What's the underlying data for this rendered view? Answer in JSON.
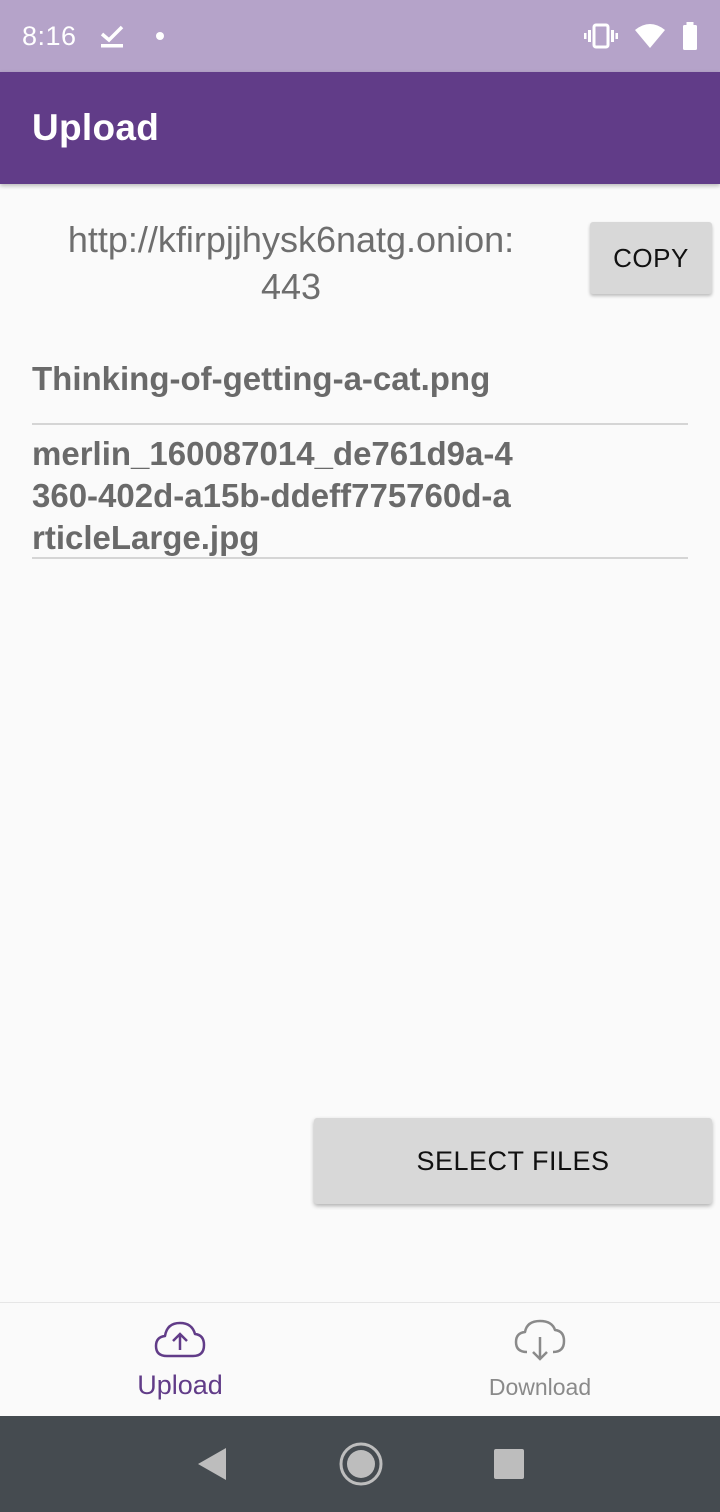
{
  "status_bar": {
    "time": "8:16",
    "left_icons": [
      "download-done-icon",
      "notification-dot-icon"
    ],
    "right_icons": [
      "vibrate-icon",
      "wifi-icon",
      "battery-icon"
    ]
  },
  "app_bar": {
    "title": "Upload",
    "color": "#613c88"
  },
  "share": {
    "url_line1": "http://kfirpjjhysk6natg.onion:",
    "url_line2": "443",
    "copy_label": "COPY"
  },
  "files": [
    {
      "lines": [
        "Thinking-of-getting-a-cat.png"
      ]
    },
    {
      "lines": [
        "merlin_160087014_de761d9a-4",
        "360-402d-a15b-ddeff775760d-a",
        "rticleLarge.jpg"
      ]
    }
  ],
  "select_files_label": "SELECT FILES",
  "bottom_nav": {
    "items": [
      {
        "label": "Upload",
        "icon": "cloud-upload-icon",
        "active": true
      },
      {
        "label": "Download",
        "icon": "cloud-download-icon",
        "active": false
      }
    ]
  },
  "system_nav": {
    "icons": [
      "back-icon",
      "home-icon",
      "recents-icon"
    ]
  },
  "colors": {
    "status_bar": "#b5a3c9",
    "app_bar": "#613c88",
    "accent": "#613c88",
    "system_nav": "#454b50"
  }
}
